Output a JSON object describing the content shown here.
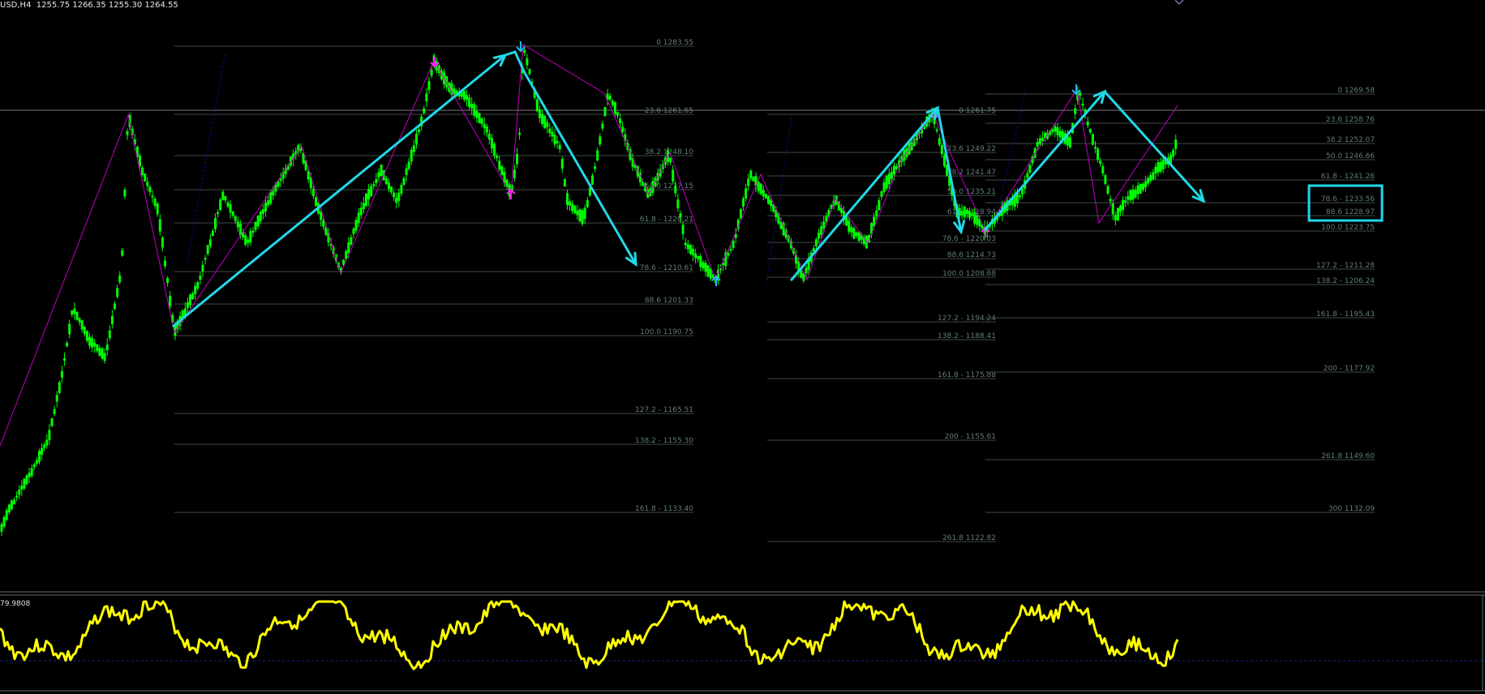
{
  "header": {
    "symbol_timeframe": "USD,H4",
    "ohlc": [
      "1255.75",
      "1266.35",
      "1255.30",
      "1264.55"
    ]
  },
  "indicator": {
    "label": "79.9808",
    "line_color": "#ffff00"
  },
  "colors": {
    "background": "#000000",
    "candle": "#00ff00",
    "fib_line": "#3f4a48",
    "fib_text": "#5f7d78",
    "annotation": "#20d8e8",
    "zigzag": "#c000c0",
    "arrow_up": "#20b8f0",
    "arrow_down": "#ff20ff",
    "channel": "#1010a0"
  },
  "fib_sets": [
    {
      "name": "fib-set-1",
      "levels": [
        {
          "label": "0 1283.55"
        },
        {
          "label": "23.6 1261.65"
        },
        {
          "label": "38.2 1248.10"
        },
        {
          "label": "50.0 1237.15"
        },
        {
          "label": "61.8 - 1226.21"
        },
        {
          "label": "78.6 - 1210.61"
        },
        {
          "label": "88.6 1201.33"
        },
        {
          "label": "100.0 1190.75"
        },
        {
          "label": "127.2 - 1165.51"
        },
        {
          "label": "138.2 - 1155.30"
        },
        {
          "label": "161.8 - 1133.40"
        }
      ]
    },
    {
      "name": "fib-set-2",
      "levels": [
        {
          "label": "0 1261.75"
        },
        {
          "label": "23.6 1249.22"
        },
        {
          "label": "38.2 1241.47"
        },
        {
          "label": "50.0 1235.21"
        },
        {
          "label": "61.8 1228.94"
        },
        {
          "label": "78.6 - 1220.03"
        },
        {
          "label": "88.6 1214.73"
        },
        {
          "label": "100.0 1208.68"
        },
        {
          "label": "127.2 - 1194.24"
        },
        {
          "label": "138.2 - 1188.41"
        },
        {
          "label": "161.8 - 1175.88"
        },
        {
          "label": "200 - 1155.61"
        },
        {
          "label": "261.8 1122.82"
        }
      ]
    },
    {
      "name": "fib-set-3",
      "levels": [
        {
          "label": "0 1269.58"
        },
        {
          "label": "23.6 1258.76"
        },
        {
          "label": "38.2 1252.07"
        },
        {
          "label": "50.0 1246.66"
        },
        {
          "label": "61.8 - 1241.26"
        },
        {
          "label": "78.6 - 1233.56"
        },
        {
          "label": "88.6 1228.97"
        },
        {
          "label": "100.0 1223.75"
        },
        {
          "label": "127.2 - 1211.28"
        },
        {
          "label": "138.2 - 1206.24"
        },
        {
          "label": "161.8 - 1195.43"
        },
        {
          "label": "200 - 1177.92"
        },
        {
          "label": "261.8 1149.60"
        },
        {
          "label": "300 1132.09"
        }
      ]
    }
  ]
}
